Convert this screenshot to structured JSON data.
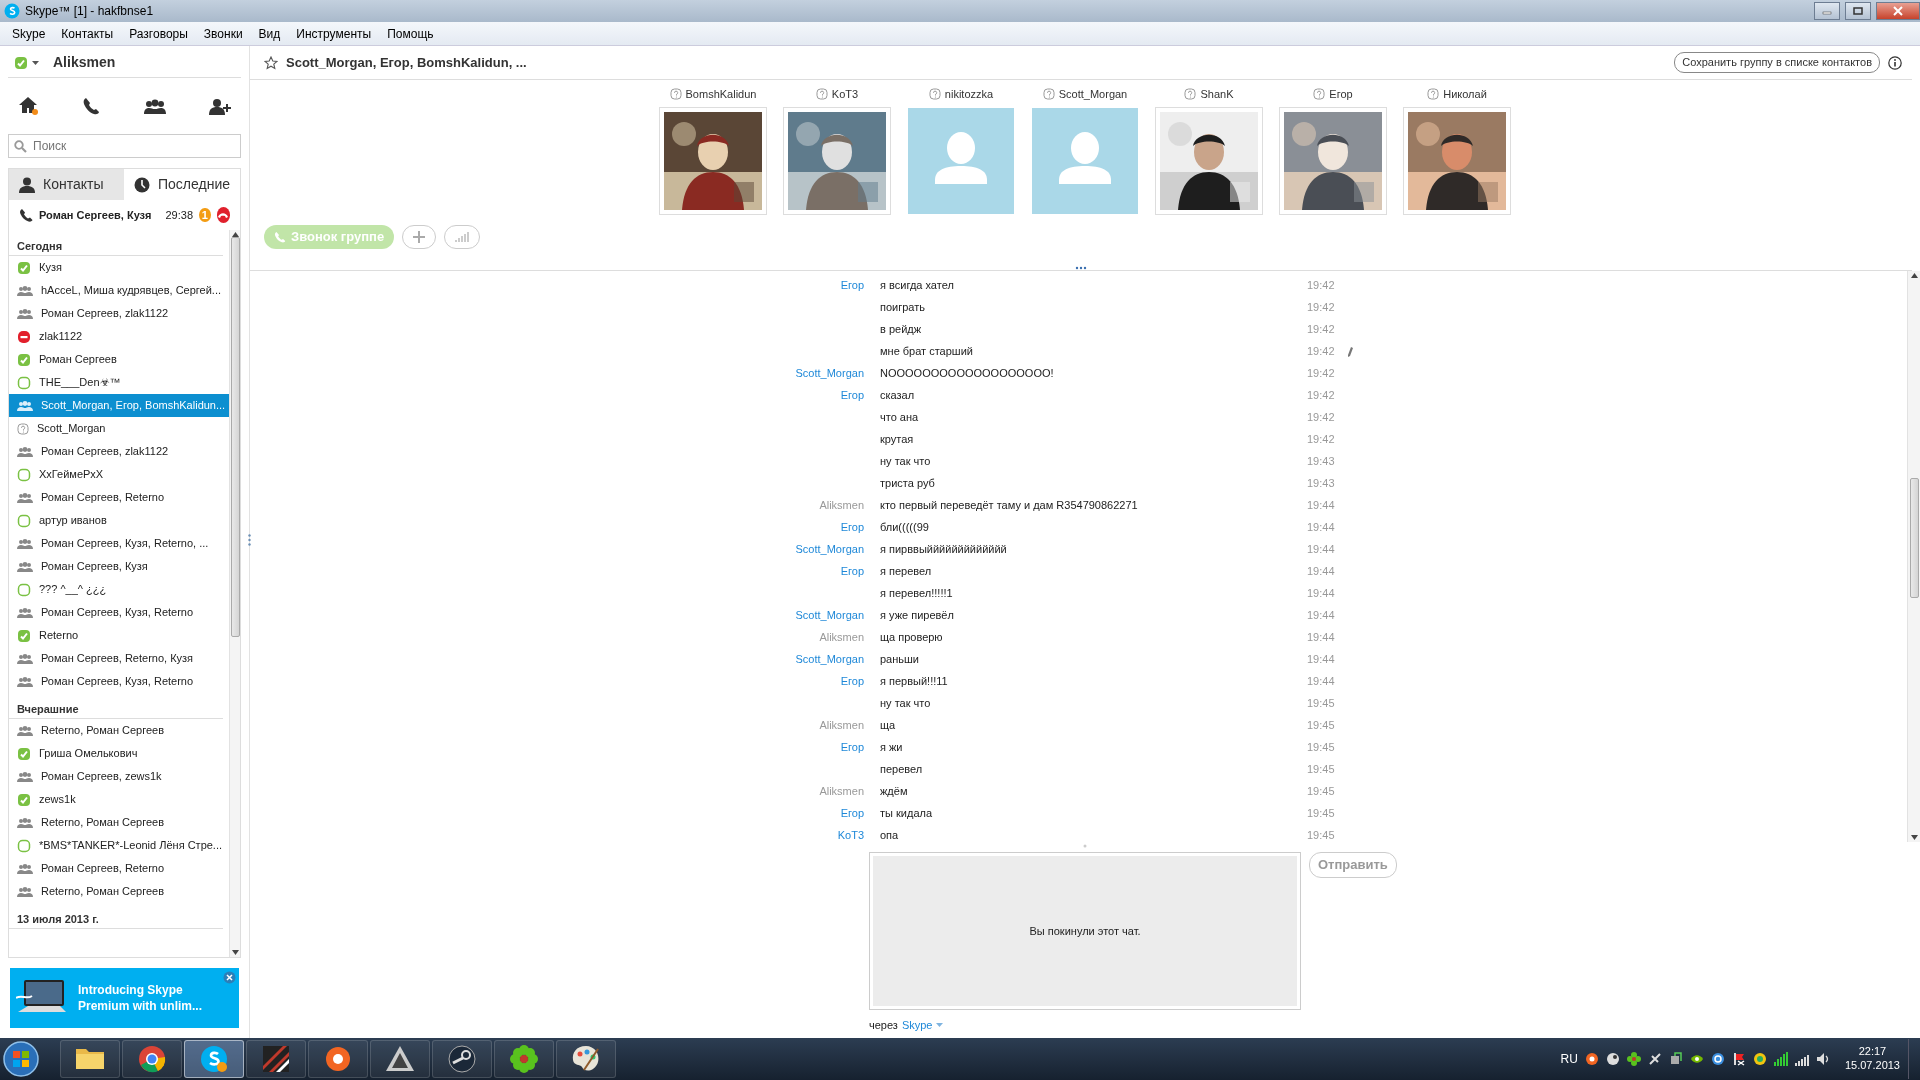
{
  "window": {
    "title": "Skype™ [1] - hakfbnse1"
  },
  "menu": [
    "Skype",
    "Контакты",
    "Разговоры",
    "Звонки",
    "Вид",
    "Инструменты",
    "Помощь"
  ],
  "profile": {
    "name": "Aliksmen",
    "online": true
  },
  "search": {
    "placeholder": "Поиск"
  },
  "tabs": [
    {
      "label": "Контакты",
      "selected": false
    },
    {
      "label": "Последние",
      "selected": true
    }
  ],
  "active_call": {
    "name": "Роман Сергеев, Кузя",
    "duration": "29:38",
    "badge": "1"
  },
  "recent": [
    {
      "heading": "Сегодня",
      "items": [
        {
          "name": "Кузя",
          "kind": "online",
          "selected": false
        },
        {
          "name": "hAcceL, Миша кудрявцев, Сергей...",
          "kind": "group",
          "selected": false
        },
        {
          "name": "Роман Сергеев, zlak1122",
          "kind": "group",
          "selected": false
        },
        {
          "name": "zlak1122",
          "kind": "dnd",
          "selected": false
        },
        {
          "name": "Роман Сергеев",
          "kind": "online",
          "selected": false
        },
        {
          "name": "ΤΗΕ___Den☣™",
          "kind": "offline",
          "selected": false
        },
        {
          "name": "Scott_Morgan, Егор, BomshKalidun...",
          "kind": "group",
          "selected": true
        },
        {
          "name": "Scott_Morgan",
          "kind": "unknown",
          "selected": false
        },
        {
          "name": "Роман Сергеев, zlak1122",
          "kind": "group",
          "selected": false
        },
        {
          "name": "XxГеймеРxX",
          "kind": "offline",
          "selected": false
        },
        {
          "name": "Роман Сергеев, Reterno",
          "kind": "group",
          "selected": false
        },
        {
          "name": "артур иванов",
          "kind": "offline",
          "selected": false
        },
        {
          "name": "Роман Сергеев, Кузя, Reterno, ...",
          "kind": "group",
          "selected": false
        },
        {
          "name": "Роман Сергеев, Кузя",
          "kind": "group",
          "selected": false
        },
        {
          "name": "??? ^__^ ¿¿¿",
          "kind": "offline",
          "selected": false
        },
        {
          "name": "Роман Сергеев, Кузя, Reterno",
          "kind": "group",
          "selected": false
        },
        {
          "name": "Reterno",
          "kind": "online",
          "selected": false
        },
        {
          "name": "Роман Сергеев, Reterno, Кузя",
          "kind": "group",
          "selected": false
        },
        {
          "name": "Роман Сергеев, Кузя, Reterno",
          "kind": "group",
          "selected": false
        }
      ]
    },
    {
      "heading": "Вчерашние",
      "items": [
        {
          "name": "Reterno, Роман Сергеев",
          "kind": "group",
          "selected": false
        },
        {
          "name": "Гриша  Омелькович",
          "kind": "online",
          "selected": false
        },
        {
          "name": "Роман Сергеев, zews1k",
          "kind": "group",
          "selected": false
        },
        {
          "name": "zews1k",
          "kind": "online",
          "selected": false
        },
        {
          "name": "Reterno, Роман Сергеев",
          "kind": "group",
          "selected": false
        },
        {
          "name": "*BMS*TANKER*-Leonid Лёня Стре...",
          "kind": "offline",
          "selected": false
        },
        {
          "name": "Роман Сергеев, Reterno",
          "kind": "group",
          "selected": false
        },
        {
          "name": "Reterno, Роман Сергеев",
          "kind": "group",
          "selected": false
        }
      ]
    },
    {
      "heading": "13 июля 2013 г."
    }
  ],
  "ad": {
    "text": "Introducing Skype Premium with unlim..."
  },
  "conversation": {
    "title": "Scott_Morgan, Егор, BomshKalidun, ...",
    "favorite": false,
    "save_button": "Сохранить группу в списке контактов"
  },
  "participants": [
    {
      "name": "BomshKalidun"
    },
    {
      "name": "KoT3"
    },
    {
      "name": "nikitozzka",
      "kind": "default"
    },
    {
      "name": "Scott_Morgan",
      "kind": "default"
    },
    {
      "name": "ShanK"
    },
    {
      "name": "Егор"
    },
    {
      "name": "Николай"
    }
  ],
  "call_button": {
    "label": "Звонок группе",
    "disabled": true
  },
  "messages": [
    {
      "sender": "Егор",
      "own": false,
      "text": "я всигда хател",
      "time": "19:42"
    },
    {
      "text": "поиграть",
      "time": "19:42"
    },
    {
      "text": "в рейдж",
      "time": "19:42"
    },
    {
      "text": "мне брат старший",
      "time": "19:42",
      "edited": true
    },
    {
      "sender": "Scott_Morgan",
      "own": false,
      "text": "NOOOOOOOOOOOOOOOOOOO!",
      "time": "19:42"
    },
    {
      "sender": "Егор",
      "own": false,
      "text": "сказал",
      "time": "19:42"
    },
    {
      "text": "что ана",
      "time": "19:42"
    },
    {
      "text": "крутая",
      "time": "19:42"
    },
    {
      "text": "ну так что",
      "time": "19:43"
    },
    {
      "text": "триста руб",
      "time": "19:43"
    },
    {
      "sender": "Aliksmen",
      "own": true,
      "text": "кто первый переведёт таму и дам R354790862271",
      "time": "19:44"
    },
    {
      "sender": "Егор",
      "own": false,
      "text": "бли(((((99",
      "time": "19:44"
    },
    {
      "sender": "Scott_Morgan",
      "own": false,
      "text": "я пирввыййййййййййййй",
      "time": "19:44"
    },
    {
      "sender": "Егор",
      "own": false,
      "text": "я перевел",
      "time": "19:44"
    },
    {
      "text": "я перевел!!!!!1",
      "time": "19:44"
    },
    {
      "sender": "Scott_Morgan",
      "own": false,
      "text": "я уже пиревёл",
      "time": "19:44"
    },
    {
      "sender": "Aliksmen",
      "own": true,
      "text": "ща проверю",
      "time": "19:44"
    },
    {
      "sender": "Scott_Morgan",
      "own": false,
      "text": "раньши",
      "time": "19:44"
    },
    {
      "sender": "Егор",
      "own": false,
      "text": "я первый!!!11",
      "time": "19:44"
    },
    {
      "text": "ну так что",
      "time": "19:45"
    },
    {
      "sender": "Aliksmen",
      "own": true,
      "text": "ща",
      "time": "19:45"
    },
    {
      "sender": "Егор",
      "own": false,
      "text": "я жи",
      "time": "19:45"
    },
    {
      "text": "перевел",
      "time": "19:45"
    },
    {
      "sender": "Aliksmen",
      "own": true,
      "text": "ждём",
      "time": "19:45"
    },
    {
      "sender": "Егор",
      "own": false,
      "text": "ты кидала",
      "time": "19:45"
    },
    {
      "sender": "KoT3",
      "own": false,
      "text": "опа",
      "time": "19:45"
    }
  ],
  "composer": {
    "notice": "Вы покинули этот чат.",
    "send": "Отправить",
    "send_disabled": true,
    "via_label": "через",
    "via": "Skype"
  },
  "taskbar": {
    "apps": [
      {
        "kind": "folder",
        "selected": false
      },
      {
        "kind": "browser",
        "selected": false
      },
      {
        "kind": "skype",
        "selected": true
      },
      {
        "kind": "stripes",
        "selected": false
      },
      {
        "kind": "ring",
        "selected": false
      },
      {
        "kind": "triangle",
        "selected": false
      },
      {
        "kind": "steam",
        "selected": false
      },
      {
        "kind": "flower",
        "selected": false
      },
      {
        "kind": "palette",
        "selected": false
      }
    ],
    "language": "RU",
    "time": "22:17",
    "date": "15.07.2013"
  }
}
